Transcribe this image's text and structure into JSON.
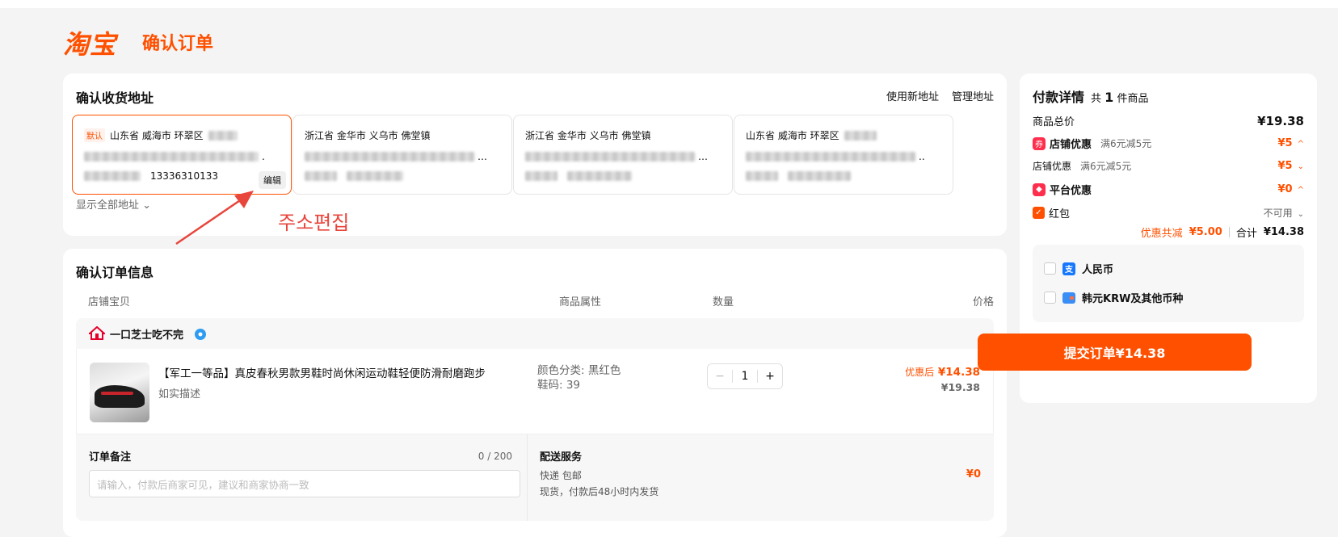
{
  "header": {
    "logo": "淘宝",
    "title": "确认订单"
  },
  "address": {
    "title": "确认收货地址",
    "actions": [
      "使用新地址",
      "管理地址"
    ],
    "default_tag": "默认",
    "cards": [
      {
        "region": "山东省 威海市 环翠区",
        "phone": "13336310133",
        "selected": true
      },
      {
        "region": "浙江省 金华市 义乌市 佛堂镇",
        "phone": "",
        "selected": false
      },
      {
        "region": "浙江省 金华市 义乌市 佛堂镇",
        "phone": "",
        "selected": false
      },
      {
        "region": "山东省 威海市 环翠区",
        "phone": "",
        "selected": false
      }
    ],
    "edit_label": "编辑",
    "show_all": "显示全部地址 ⌄"
  },
  "annotation": {
    "text": "주소편집",
    "color": "#e8453c"
  },
  "order": {
    "title": "确认订单信息",
    "columns": [
      "店铺宝贝",
      "商品属性",
      "数量",
      "价格"
    ],
    "shop_name": "一口芝士吃不完",
    "product": {
      "title": "【军工一等品】真皮春秋男款男鞋时尚休闲运动鞋轻便防滑耐磨跑步",
      "subtitle": "如实描述",
      "attr_color": "颜色分类: 黑红色",
      "attr_size": "鞋码: 39",
      "quantity": "1",
      "discount_label": "优惠后",
      "discount_price": "¥14.38",
      "original_price": "¥19.38"
    },
    "note": {
      "title": "订单备注",
      "count": "0 / 200",
      "placeholder": "请输入，付款后商家可见，建议和商家协商一致"
    },
    "shipping": {
      "title": "配送服务",
      "method": "快递 包邮",
      "desc": "现货，付款后48小时内发货",
      "price": "¥0"
    }
  },
  "payment": {
    "title": "付款详情",
    "count_prefix": "共",
    "count": "1",
    "count_suffix": "件商品",
    "total_label": "商品总价",
    "total_value": "¥19.38",
    "store_discount_label": "店铺优惠",
    "store_discount_rule": "满6元减5元",
    "store_discount_value": "¥5",
    "store_discount_sub_label": "店铺优惠",
    "store_discount_sub_rule": "满6元减5元",
    "store_discount_sub_value": "¥5",
    "platform_discount_label": "平台优惠",
    "platform_discount_value": "¥0",
    "redpacket_label": "红包",
    "redpacket_status": "不可用",
    "saved_label": "优惠共减",
    "saved_value": "¥5.00",
    "sum_label": "合计",
    "sum_value": "¥14.38",
    "currencies": [
      "人民币",
      "韩元KRW及其他币种"
    ],
    "submit": "提交订单¥14.38"
  },
  "colors": {
    "brand": "#ff5000",
    "annotation": "#e8453c"
  }
}
